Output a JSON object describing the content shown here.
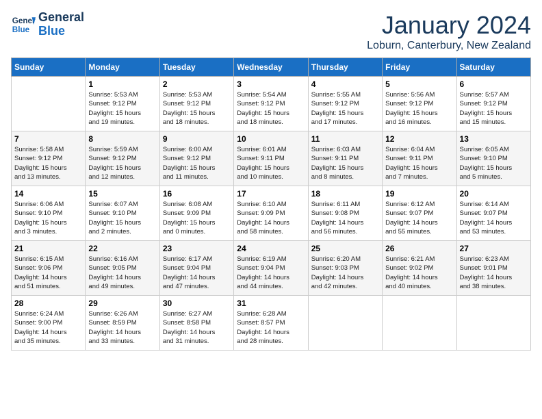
{
  "header": {
    "logo_line1": "General",
    "logo_line2": "Blue",
    "month": "January 2024",
    "location": "Loburn, Canterbury, New Zealand"
  },
  "days_of_week": [
    "Sunday",
    "Monday",
    "Tuesday",
    "Wednesday",
    "Thursday",
    "Friday",
    "Saturday"
  ],
  "weeks": [
    [
      {
        "day": "",
        "info": ""
      },
      {
        "day": "1",
        "info": "Sunrise: 5:53 AM\nSunset: 9:12 PM\nDaylight: 15 hours\nand 19 minutes."
      },
      {
        "day": "2",
        "info": "Sunrise: 5:53 AM\nSunset: 9:12 PM\nDaylight: 15 hours\nand 18 minutes."
      },
      {
        "day": "3",
        "info": "Sunrise: 5:54 AM\nSunset: 9:12 PM\nDaylight: 15 hours\nand 18 minutes."
      },
      {
        "day": "4",
        "info": "Sunrise: 5:55 AM\nSunset: 9:12 PM\nDaylight: 15 hours\nand 17 minutes."
      },
      {
        "day": "5",
        "info": "Sunrise: 5:56 AM\nSunset: 9:12 PM\nDaylight: 15 hours\nand 16 minutes."
      },
      {
        "day": "6",
        "info": "Sunrise: 5:57 AM\nSunset: 9:12 PM\nDaylight: 15 hours\nand 15 minutes."
      }
    ],
    [
      {
        "day": "7",
        "info": "Sunrise: 5:58 AM\nSunset: 9:12 PM\nDaylight: 15 hours\nand 13 minutes."
      },
      {
        "day": "8",
        "info": "Sunrise: 5:59 AM\nSunset: 9:12 PM\nDaylight: 15 hours\nand 12 minutes."
      },
      {
        "day": "9",
        "info": "Sunrise: 6:00 AM\nSunset: 9:12 PM\nDaylight: 15 hours\nand 11 minutes."
      },
      {
        "day": "10",
        "info": "Sunrise: 6:01 AM\nSunset: 9:11 PM\nDaylight: 15 hours\nand 10 minutes."
      },
      {
        "day": "11",
        "info": "Sunrise: 6:03 AM\nSunset: 9:11 PM\nDaylight: 15 hours\nand 8 minutes."
      },
      {
        "day": "12",
        "info": "Sunrise: 6:04 AM\nSunset: 9:11 PM\nDaylight: 15 hours\nand 7 minutes."
      },
      {
        "day": "13",
        "info": "Sunrise: 6:05 AM\nSunset: 9:10 PM\nDaylight: 15 hours\nand 5 minutes."
      }
    ],
    [
      {
        "day": "14",
        "info": "Sunrise: 6:06 AM\nSunset: 9:10 PM\nDaylight: 15 hours\nand 3 minutes."
      },
      {
        "day": "15",
        "info": "Sunrise: 6:07 AM\nSunset: 9:10 PM\nDaylight: 15 hours\nand 2 minutes."
      },
      {
        "day": "16",
        "info": "Sunrise: 6:08 AM\nSunset: 9:09 PM\nDaylight: 15 hours\nand 0 minutes."
      },
      {
        "day": "17",
        "info": "Sunrise: 6:10 AM\nSunset: 9:09 PM\nDaylight: 14 hours\nand 58 minutes."
      },
      {
        "day": "18",
        "info": "Sunrise: 6:11 AM\nSunset: 9:08 PM\nDaylight: 14 hours\nand 56 minutes."
      },
      {
        "day": "19",
        "info": "Sunrise: 6:12 AM\nSunset: 9:07 PM\nDaylight: 14 hours\nand 55 minutes."
      },
      {
        "day": "20",
        "info": "Sunrise: 6:14 AM\nSunset: 9:07 PM\nDaylight: 14 hours\nand 53 minutes."
      }
    ],
    [
      {
        "day": "21",
        "info": "Sunrise: 6:15 AM\nSunset: 9:06 PM\nDaylight: 14 hours\nand 51 minutes."
      },
      {
        "day": "22",
        "info": "Sunrise: 6:16 AM\nSunset: 9:05 PM\nDaylight: 14 hours\nand 49 minutes."
      },
      {
        "day": "23",
        "info": "Sunrise: 6:17 AM\nSunset: 9:04 PM\nDaylight: 14 hours\nand 47 minutes."
      },
      {
        "day": "24",
        "info": "Sunrise: 6:19 AM\nSunset: 9:04 PM\nDaylight: 14 hours\nand 44 minutes."
      },
      {
        "day": "25",
        "info": "Sunrise: 6:20 AM\nSunset: 9:03 PM\nDaylight: 14 hours\nand 42 minutes."
      },
      {
        "day": "26",
        "info": "Sunrise: 6:21 AM\nSunset: 9:02 PM\nDaylight: 14 hours\nand 40 minutes."
      },
      {
        "day": "27",
        "info": "Sunrise: 6:23 AM\nSunset: 9:01 PM\nDaylight: 14 hours\nand 38 minutes."
      }
    ],
    [
      {
        "day": "28",
        "info": "Sunrise: 6:24 AM\nSunset: 9:00 PM\nDaylight: 14 hours\nand 35 minutes."
      },
      {
        "day": "29",
        "info": "Sunrise: 6:26 AM\nSunset: 8:59 PM\nDaylight: 14 hours\nand 33 minutes."
      },
      {
        "day": "30",
        "info": "Sunrise: 6:27 AM\nSunset: 8:58 PM\nDaylight: 14 hours\nand 31 minutes."
      },
      {
        "day": "31",
        "info": "Sunrise: 6:28 AM\nSunset: 8:57 PM\nDaylight: 14 hours\nand 28 minutes."
      },
      {
        "day": "",
        "info": ""
      },
      {
        "day": "",
        "info": ""
      },
      {
        "day": "",
        "info": ""
      }
    ]
  ]
}
